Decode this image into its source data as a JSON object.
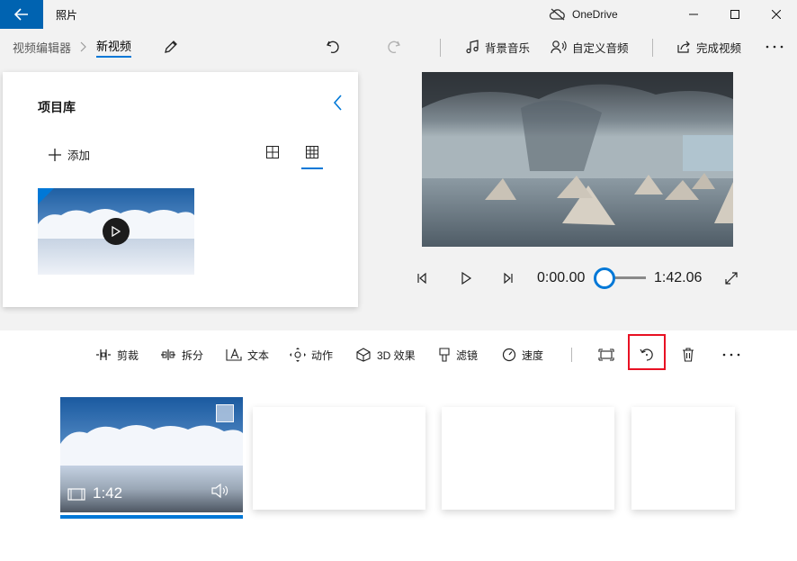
{
  "titlebar": {
    "app_title": "照片",
    "onedrive_label": "OneDrive"
  },
  "breadcrumb": {
    "parent": "视频编辑器",
    "current": "新视频"
  },
  "toolbar": {
    "background_music": "背景音乐",
    "custom_audio": "自定义音频",
    "finish_video": "完成视频"
  },
  "library": {
    "title": "项目库",
    "add_label": "添加"
  },
  "player": {
    "current_time": "0:00.00",
    "total_time": "1:42.06",
    "progress_fraction": 0.0
  },
  "edit_tools": {
    "trim": "剪裁",
    "split": "拆分",
    "text": "文本",
    "motion": "动作",
    "effects_3d": "3D 效果",
    "filters": "滤镜",
    "speed": "速度"
  },
  "storyboard": {
    "clip_duration": "1:42"
  },
  "colors": {
    "accent": "#0078d7",
    "titlebar_back": "#0063b1",
    "highlight": "#e81123"
  }
}
